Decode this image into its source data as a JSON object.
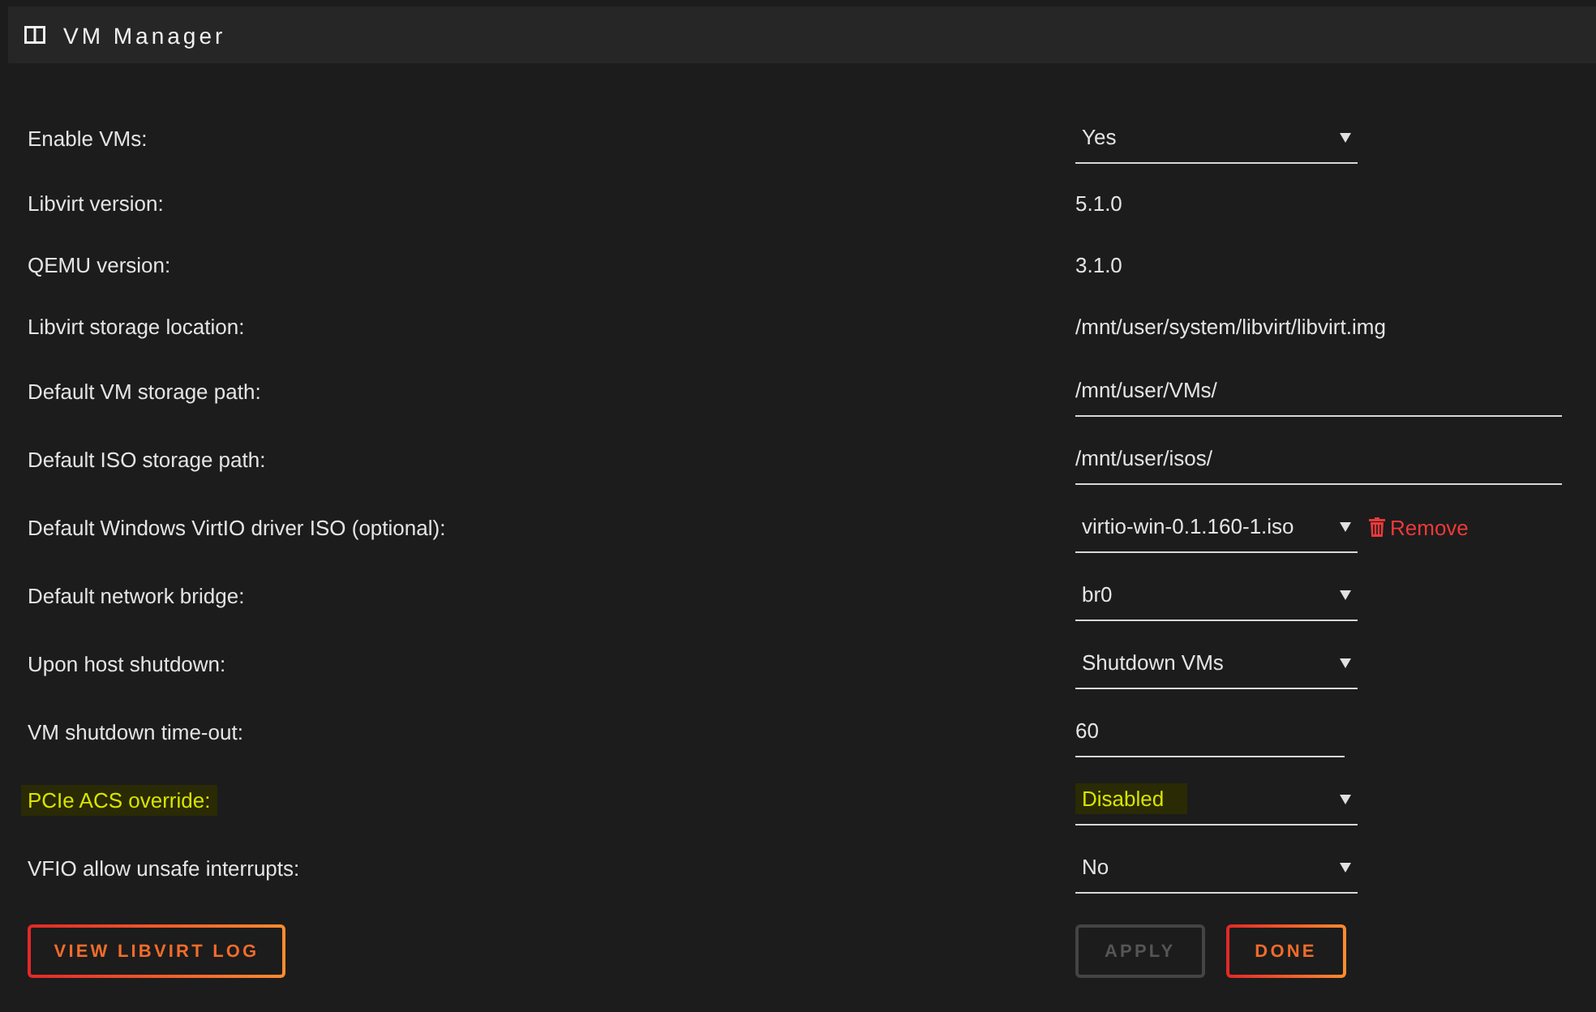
{
  "header": {
    "title": "VM Manager"
  },
  "settings": [
    {
      "label": "Enable VMs:",
      "kind": "select",
      "value": "Yes",
      "highlighted": false
    },
    {
      "label": "Libvirt version:",
      "kind": "static",
      "value": "5.1.0",
      "highlighted": false
    },
    {
      "label": "QEMU version:",
      "kind": "static",
      "value": "3.1.0",
      "highlighted": false
    },
    {
      "label": "Libvirt storage location:",
      "kind": "static",
      "value": "/mnt/user/system/libvirt/libvirt.img",
      "highlighted": false
    },
    {
      "label": "Default VM storage path:",
      "kind": "text",
      "value": "/mnt/user/VMs/",
      "highlighted": false
    },
    {
      "label": "Default ISO storage path:",
      "kind": "text",
      "value": "/mnt/user/isos/",
      "highlighted": false
    },
    {
      "label": "Default Windows VirtIO driver ISO (optional):",
      "kind": "select",
      "value": "virtio-win-0.1.160-1.iso",
      "action": "Remove",
      "highlighted": false
    },
    {
      "label": "Default network bridge:",
      "kind": "select",
      "value": "br0",
      "highlighted": false
    },
    {
      "label": "Upon host shutdown:",
      "kind": "select",
      "value": "Shutdown VMs",
      "highlighted": false
    },
    {
      "label": "VM shutdown time-out:",
      "kind": "number",
      "value": "60",
      "highlighted": false
    },
    {
      "label": "PCIe ACS override:",
      "kind": "select",
      "value": "Disabled",
      "highlighted": true
    },
    {
      "label": "VFIO allow unsafe interrupts:",
      "kind": "select",
      "value": "No",
      "highlighted": false
    }
  ],
  "left_buttons": [
    {
      "label": "VIEW LIBVIRT LOG",
      "disabled": false
    }
  ],
  "right_buttons": [
    {
      "label": "APPLY",
      "disabled": true
    },
    {
      "label": "DONE",
      "disabled": false
    }
  ]
}
